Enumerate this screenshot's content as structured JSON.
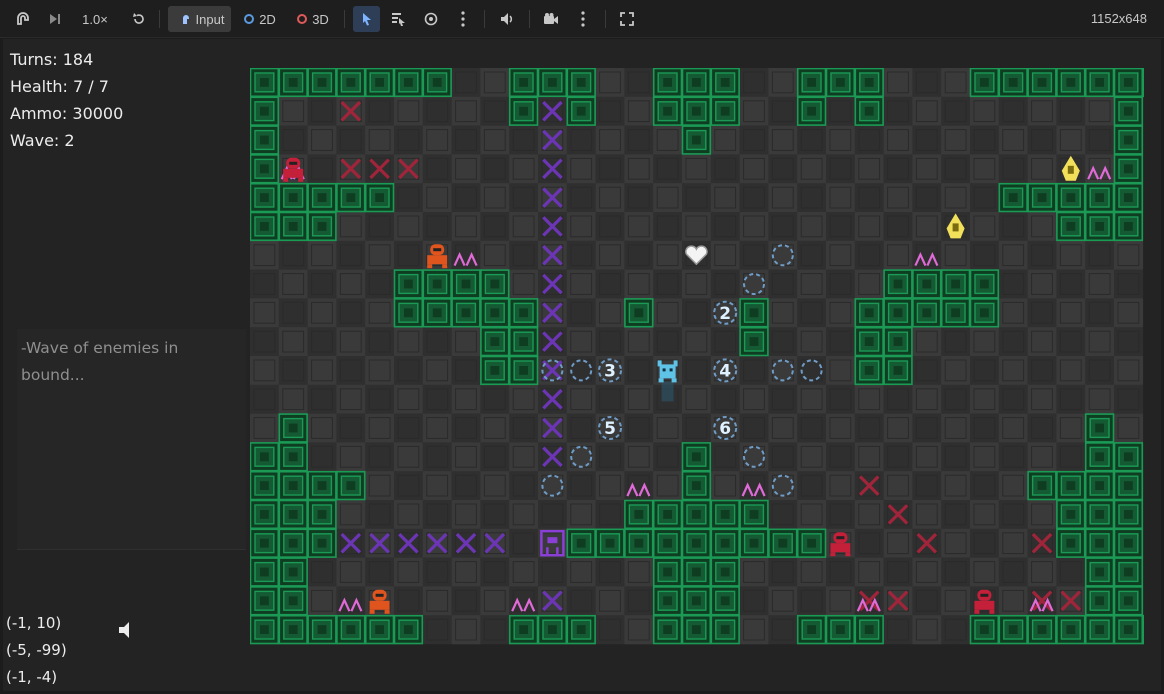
{
  "toolbar": {
    "speed": "1.0×",
    "input_label": "Input",
    "mode_2d": "2D",
    "mode_3d": "3D",
    "resolution": "1152x648"
  },
  "hud": {
    "turns": "Turns: 184",
    "health": "Health: 7 / 7",
    "ammo": "Ammo: 30000",
    "wave": "Wave: 2"
  },
  "message": {
    "line1": "-Wave of enemies in",
    "line2": "bound..."
  },
  "coords": [
    "(-1, 10)",
    "(-5, -99)",
    "(-1, -4)"
  ],
  "colors": {
    "wall": "#1b9a55",
    "floor_a": "#2f2f2f",
    "floor_b": "#3a3a3a",
    "purple_x": "#6b35b5",
    "red_x": "#a0243a",
    "spike": "#e06ad8",
    "player": "#5fc3e8",
    "orange_enemy": "#e0541e",
    "red_enemy": "#c4203a",
    "yellow_enemy": "#f2e05a"
  },
  "board": {
    "cols": 31,
    "rows": 20,
    "walls": "0-6@0;9-11@0;14-16@0;19-21@0;25-31@0;0@1;9@1;11@1;14-16@1;19@1;21@1;30@1;0@2;15@2;30@2;0@3;30@3;0-4@4;26-30@4;0-2@5;28-30@5;22-25@7;5-8@7;5-9@8;13@8;17@8;21-25@8;8-9@9;17@9;21-22@9;8-9@10;21-22@10;1@12;29@12;0-1@13;15@13;29-30@13;0-3@14;15@14;27-30@14;0-2@15;13-17@15;28-30@15;0-2@16;11-19@16;28-30@16;0-1@17;14-16@17;29-30@17;0-1@18;14-16@18;29-30@18;0-5@19;9-11@19;14-16@19;19-21@19;25-31@19",
    "purple_x": [
      [
        10,
        1
      ],
      [
        10,
        2
      ],
      [
        10,
        3
      ],
      [
        10,
        4
      ],
      [
        10,
        5
      ],
      [
        10,
        6
      ],
      [
        10,
        7
      ],
      [
        10,
        8
      ],
      [
        10,
        9
      ],
      [
        10,
        10
      ],
      [
        10,
        11
      ],
      [
        10,
        12
      ],
      [
        10,
        13
      ],
      [
        3,
        16
      ],
      [
        4,
        16
      ],
      [
        5,
        16
      ],
      [
        6,
        16
      ],
      [
        7,
        16
      ],
      [
        8,
        16
      ],
      [
        10,
        18
      ]
    ],
    "red_x": [
      [
        3,
        1
      ],
      [
        3,
        3
      ],
      [
        4,
        3
      ],
      [
        5,
        3
      ],
      [
        21,
        14
      ],
      [
        22,
        15
      ],
      [
        23,
        16
      ],
      [
        27,
        16
      ],
      [
        21,
        18
      ],
      [
        22,
        18
      ],
      [
        27,
        18
      ],
      [
        28,
        18
      ]
    ],
    "dashed_circles": [
      [
        18,
        6
      ],
      [
        17,
        7
      ],
      [
        11,
        10
      ],
      [
        18,
        10
      ],
      [
        19,
        10
      ],
      [
        11,
        13
      ],
      [
        17,
        13
      ],
      [
        18,
        14
      ],
      [
        10,
        10
      ],
      [
        10,
        14
      ]
    ],
    "numbered": [
      {
        "n": "2",
        "c": 16,
        "r": 8
      },
      {
        "n": "3",
        "c": 12,
        "r": 10
      },
      {
        "n": "4",
        "c": 16,
        "r": 10
      },
      {
        "n": "5",
        "c": 12,
        "r": 12
      },
      {
        "n": "6",
        "c": 16,
        "r": 12
      }
    ],
    "spikes": [
      [
        1,
        3
      ],
      [
        29,
        3
      ],
      [
        7,
        6
      ],
      [
        23,
        6
      ],
      [
        13,
        14
      ],
      [
        17,
        14
      ],
      [
        3,
        18
      ],
      [
        9,
        18
      ],
      [
        21,
        18
      ],
      [
        27,
        18
      ]
    ],
    "enemies": [
      {
        "type": "red",
        "c": 1,
        "r": 3
      },
      {
        "type": "orange",
        "c": 6,
        "r": 6
      },
      {
        "type": "orange",
        "c": 4,
        "r": 18
      },
      {
        "type": "red",
        "c": 20,
        "r": 16
      },
      {
        "type": "red",
        "c": 25,
        "r": 18
      },
      {
        "type": "yellow",
        "c": 28,
        "r": 3
      },
      {
        "type": "yellow",
        "c": 24,
        "r": 5
      },
      {
        "type": "purple",
        "c": 10,
        "r": 16
      }
    ],
    "heart": [
      15,
      6
    ],
    "player": [
      14,
      10
    ]
  }
}
